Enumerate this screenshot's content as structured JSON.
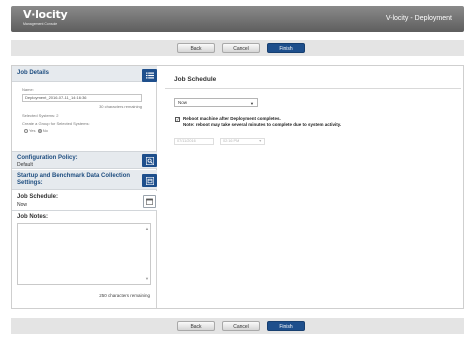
{
  "header": {
    "logo": "V·locity",
    "logo_sub": "Management Console",
    "title": "V-locity - Deployment"
  },
  "buttons": {
    "back": "Back",
    "cancel": "Cancel",
    "finish": "Finish"
  },
  "left": {
    "job_details": {
      "title": "Job Details",
      "name_label": "Name:",
      "name_value": "Deployment_2016-07-11_14:16:36",
      "name_remaining": "30 characters remaining",
      "selected_systems": "Selected Systems: 2",
      "create_group_label": "Create a Group for Selected Systems:",
      "yes": "Yes",
      "no": "No"
    },
    "config_policy": {
      "title": "Configuration Policy:",
      "value": "Default"
    },
    "startup": {
      "title": "Startup and Benchmark Data Collection Settings:"
    },
    "job_schedule": {
      "title": "Job Schedule:",
      "value": "Now"
    },
    "job_notes": {
      "title": "Job Notes:",
      "remaining": "250 characters remaining"
    }
  },
  "right": {
    "title": "Job Schedule",
    "schedule_select": "Now",
    "reboot_label": "Reboot machine after Deployment completes.",
    "reboot_note": "Note: reboot may take several minutes to complete due to system activity.",
    "date_value": "07/11/2016",
    "time_value": "02:16 PM"
  },
  "colors": {
    "accent": "#1e4f8c",
    "section_title": "#1f4e80",
    "section_bg": "#e6eaee"
  },
  "icons": {
    "job_details": "list-icon",
    "config_policy": "magnify-icon",
    "startup": "settings-window-icon",
    "job_schedule": "calendar-icon"
  }
}
